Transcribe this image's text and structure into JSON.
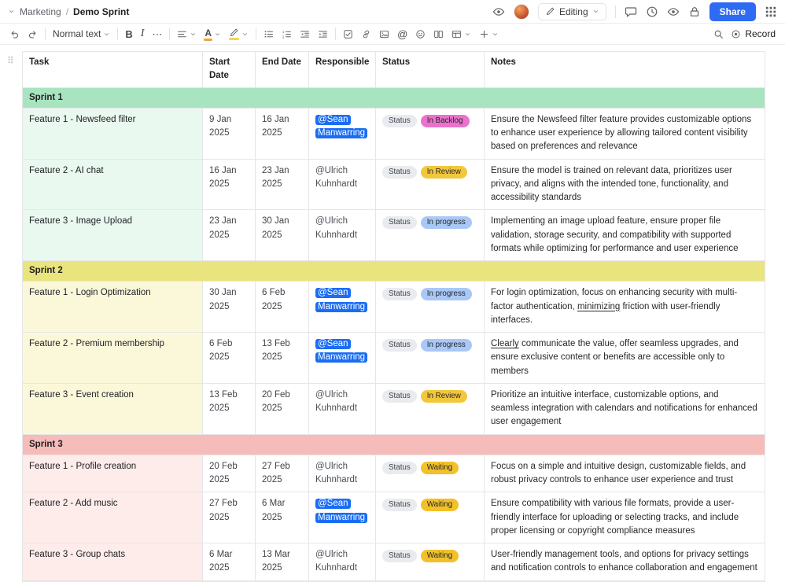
{
  "topbar": {
    "breadcrumb": {
      "parent": "Marketing",
      "separator": "/",
      "current": "Demo Sprint"
    },
    "mode_label": "Editing",
    "share_label": "Share"
  },
  "toolbar": {
    "paragraph_style": "Normal text",
    "bold_label": "B",
    "italic_label": "I",
    "overflow_glyph": "⋯",
    "mention_glyph": "@",
    "color_letter": "A",
    "record_label": "Record"
  },
  "colors": {
    "accent_blue": "#2e6bf2",
    "mention_blue": "#1a6df4"
  },
  "table": {
    "drag_handle_glyph": "⠿",
    "columns": [
      "Task",
      "Start Date",
      "End Date",
      "Responsible",
      "Status",
      "Notes"
    ],
    "status_label": "Status",
    "status_colors": {
      "In Backlog": "#e972cb",
      "In Review": "#f3c73c",
      "In progress": "#a9c8f7",
      "Waiting": "#f2c029"
    },
    "sections": [
      {
        "name": "Sprint 1",
        "header_color": "#a9e4c0",
        "row_tint": "#e9f9f0",
        "rows": [
          {
            "task": "Feature 1 - Newsfeed filter",
            "start": "9 Jan 2025",
            "end": "16 Jan 2025",
            "responsible": "@Sean Manwarring",
            "responsible_highlight": true,
            "status": "In Backlog",
            "notes": "Ensure the Newsfeed filter feature provides customizable options to enhance user experience by allowing tailored content visibility based on preferences and relevance"
          },
          {
            "task": "Feature 2 - AI chat",
            "start": "16 Jan 2025",
            "end": "23 Jan 2025",
            "responsible": "@Ulrich Kuhnhardt",
            "responsible_highlight": false,
            "status": "In Review",
            "notes": "Ensure the model is trained on relevant data, prioritizes user privacy, and aligns with the intended tone, functionality, and accessibility standards"
          },
          {
            "task": "Feature 3 - Image Upload",
            "start": "23 Jan 2025",
            "end": "30 Jan 2025",
            "responsible": "@Ulrich Kuhnhardt",
            "responsible_highlight": false,
            "status": "In progress",
            "notes": "Implementing an image upload feature, ensure proper file validation, storage security, and compatibility with supported formats while optimizing for performance and user experience"
          }
        ]
      },
      {
        "name": "Sprint 2",
        "header_color": "#e9e47e",
        "row_tint": "#fbf8da",
        "rows": [
          {
            "task": "Feature 1 - Login Optimization",
            "start": "30 Jan 2025",
            "end": "6 Feb 2025",
            "responsible": "@Sean Manwarring",
            "responsible_highlight": true,
            "status": "In progress",
            "notes": "For login optimization, focus on enhancing security with multi-factor authentication, minimizing friction with user-friendly interfaces.",
            "notes_underline": "minimizing"
          },
          {
            "task": "Feature 2 - Premium membership",
            "start": "6 Feb 2025",
            "end": "13 Feb 2025",
            "responsible": "@Sean Manwarring",
            "responsible_highlight": true,
            "status": "In progress",
            "notes": "Clearly communicate the value, offer seamless upgrades, and ensure exclusive content or benefits are accessible only to members",
            "notes_underline": "Clearly"
          },
          {
            "task": "Feature 3 - Event creation",
            "start": "13 Feb 2025",
            "end": "20 Feb 2025",
            "responsible": "@Ulrich Kuhnhardt",
            "responsible_highlight": false,
            "status": "In Review",
            "notes": "Prioritize an intuitive interface, customizable options, and seamless integration with calendars and notifications for enhanced user engagement"
          }
        ]
      },
      {
        "name": "Sprint 3",
        "header_color": "#f6bcba",
        "row_tint": "#fdecea",
        "rows": [
          {
            "task": "Feature 1 - Profile creation",
            "start": "20 Feb 2025",
            "end": "27 Feb 2025",
            "responsible": "@Ulrich Kuhnhardt",
            "responsible_highlight": false,
            "status": "Waiting",
            "notes": "Focus on a simple and intuitive design, customizable fields, and robust privacy controls to enhance user experience and trust"
          },
          {
            "task": "Feature 2 - Add music",
            "start": "27 Feb 2025",
            "end": "6 Mar 2025",
            "responsible": "@Sean Manwarring",
            "responsible_highlight": true,
            "status": "Waiting",
            "notes": "Ensure compatibility with various file formats, provide a user-friendly interface for uploading or selecting tracks, and include proper licensing or copyright compliance measures"
          },
          {
            "task": "Feature 3 - Group chats",
            "start": "6 Mar 2025",
            "end": "13 Mar 2025",
            "responsible": "@Ulrich Kuhnhardt",
            "responsible_highlight": false,
            "status": "Waiting",
            "notes": "User-friendly management tools, and options for privacy settings and notification controls to enhance collaboration and engagement"
          }
        ]
      }
    ]
  }
}
